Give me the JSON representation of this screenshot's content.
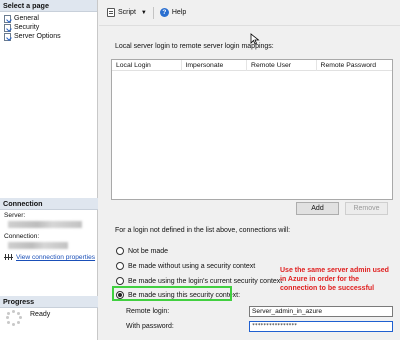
{
  "left": {
    "select_page_title": "Select a page",
    "pages": [
      {
        "label": "General"
      },
      {
        "label": "Security"
      },
      {
        "label": "Server Options"
      }
    ],
    "connection_title": "Connection",
    "server_label": "Server:",
    "connection_label": "Connection:",
    "view_connection_link": "View connection properties",
    "progress_title": "Progress",
    "status": "Ready"
  },
  "toolbar": {
    "script_label": "Script",
    "help_label": "Help"
  },
  "mappings": {
    "label": "Local server login to remote server login mappings:",
    "columns": [
      "Local Login",
      "Impersonate",
      "Remote User",
      "Remote Password"
    ],
    "add_button": "Add",
    "remove_button": "Remove"
  },
  "context": {
    "label": "For a login not defined in the list above, connections will:",
    "options": [
      {
        "label": "Not be made",
        "selected": false
      },
      {
        "label": "Be made without using a security context",
        "selected": false
      },
      {
        "label": "Be made using the login's current security context",
        "selected": false
      },
      {
        "label": "Be made using this security context:",
        "selected": true
      }
    ],
    "remote_login_label": "Remote login:",
    "remote_login_value": "Server_admin_in_azure",
    "password_label": "With password:",
    "password_value": "****************"
  },
  "annotation": "Use the same server admin used in Azure in order for the connection to be successful",
  "colors": {
    "annotation": "#e02020",
    "highlight": "#41d040",
    "link": "#1a4fb8",
    "section_header": "#dfe6ef"
  }
}
